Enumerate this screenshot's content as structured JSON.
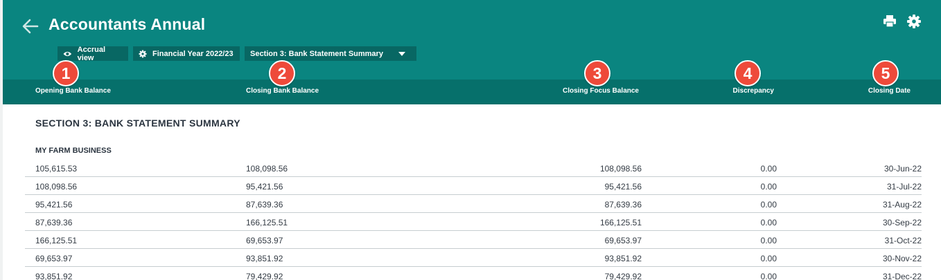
{
  "header": {
    "title": "Accountants Annual",
    "filters": {
      "view_label": "Accrual view",
      "year_label": "Financial Year 2022/23",
      "section_label": "Section 3: Bank Statement Summary"
    },
    "icons": [
      "back-arrow-icon",
      "printer-icon",
      "gear-icon",
      "eye-icon",
      "gear-icon",
      "caret-down-icon"
    ],
    "colors": {
      "header_bg": "#0a8580",
      "column_bar_bg": "#06706b",
      "chip_bg": "#086763",
      "badge_bg": "#ee4a3a"
    }
  },
  "columns": [
    {
      "label": "Opening Bank Balance",
      "badge": "1"
    },
    {
      "label": "Closing Bank Balance",
      "badge": "2"
    },
    {
      "label": "Closing Focus Balance",
      "badge": "3"
    },
    {
      "label": "Discrepancy",
      "badge": "4"
    },
    {
      "label": "Closing Date",
      "badge": "5"
    }
  ],
  "report": {
    "section_title": "SECTION 3: BANK STATEMENT SUMMARY",
    "group_label": "MY FARM BUSINESS",
    "rows": [
      [
        "105,615.53",
        "108,098.56",
        "108,098.56",
        "0.00",
        "30-Jun-22"
      ],
      [
        "108,098.56",
        "95,421.56",
        "95,421.56",
        "0.00",
        "31-Jul-22"
      ],
      [
        "95,421.56",
        "87,639.36",
        "87,639.36",
        "0.00",
        "31-Aug-22"
      ],
      [
        "87,639.36",
        "166,125.51",
        "166,125.51",
        "0.00",
        "30-Sep-22"
      ],
      [
        "166,125.51",
        "69,653.97",
        "69,653.97",
        "0.00",
        "31-Oct-22"
      ],
      [
        "69,653.97",
        "93,851.92",
        "93,851.92",
        "0.00",
        "30-Nov-22"
      ],
      [
        "93,851.92",
        "79,429.92",
        "79,429.92",
        "0.00",
        "31-Dec-22"
      ]
    ]
  }
}
